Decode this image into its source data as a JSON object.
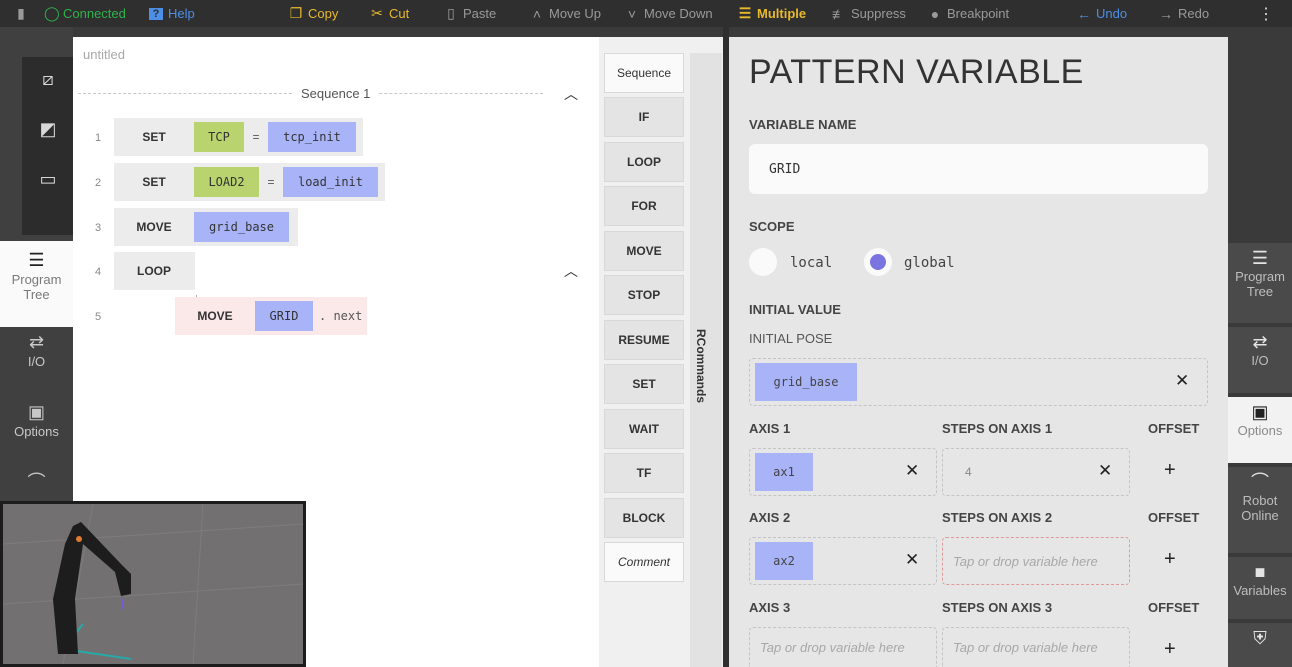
{
  "toolbar": {
    "connected": "Connected",
    "help": "Help",
    "copy": "Copy",
    "cut": "Cut",
    "paste": "Paste",
    "move_up": "Move Up",
    "move_down": "Move Down",
    "multiple": "Multiple",
    "suppress": "Suppress",
    "breakpoint": "Breakpoint",
    "undo": "Undo",
    "redo": "Redo",
    "more": "⋮",
    "colors": {
      "connected": "#2fb34a",
      "accent": "#4d8fe6",
      "multiple": "#e8b92e"
    }
  },
  "left_rail": {
    "program_tree": "Program Tree",
    "io": "I/O",
    "options": "Options"
  },
  "editor": {
    "doc_title": "untitled",
    "sequence_label": "Sequence 1",
    "lines": [
      {
        "num": "1",
        "kw": "SET",
        "a": "TCP",
        "op": "=",
        "b": "tcp_init"
      },
      {
        "num": "2",
        "kw": "SET",
        "a": "LOAD2",
        "op": "=",
        "b": "load_init"
      },
      {
        "num": "3",
        "kw": "MOVE",
        "b": "grid_base"
      },
      {
        "num": "4",
        "kw": "LOOP"
      },
      {
        "num": "5",
        "kw": "MOVE",
        "b": "GRID",
        "suffix": ". next"
      }
    ]
  },
  "commands": {
    "items": [
      "Sequence",
      "IF",
      "LOOP",
      "FOR",
      "MOVE",
      "STOP",
      "RESUME",
      "SET",
      "WAIT",
      "TF",
      "BLOCK",
      "Comment"
    ],
    "strip_label": "RCommands"
  },
  "props": {
    "title": "PATTERN VARIABLE",
    "variable_name_label": "VARIABLE NAME",
    "variable_name": "GRID",
    "scope_label": "SCOPE",
    "scope_local": "local",
    "scope_global": "global",
    "scope_selected": "global",
    "initial_value_label": "INITIAL VALUE",
    "initial_pose_label": "INITIAL POSE",
    "initial_pose": "grid_base",
    "axis1_label": "AXIS 1",
    "axis1_value": "ax1",
    "steps1_label": "STEPS ON AXIS 1",
    "steps1_value": "4",
    "offset_label": "OFFSET",
    "axis2_label": "AXIS 2",
    "axis2_value": "ax2",
    "steps2_label": "STEPS ON AXIS 2",
    "axis3_label": "AXIS 3",
    "steps3_label": "STEPS ON AXIS 3",
    "placeholder": "Tap or drop variable here"
  },
  "right_rail": {
    "program_tree": "Program Tree",
    "io": "I/O",
    "options": "Options",
    "robot_online": "Robot Online",
    "variables": "Variables"
  }
}
